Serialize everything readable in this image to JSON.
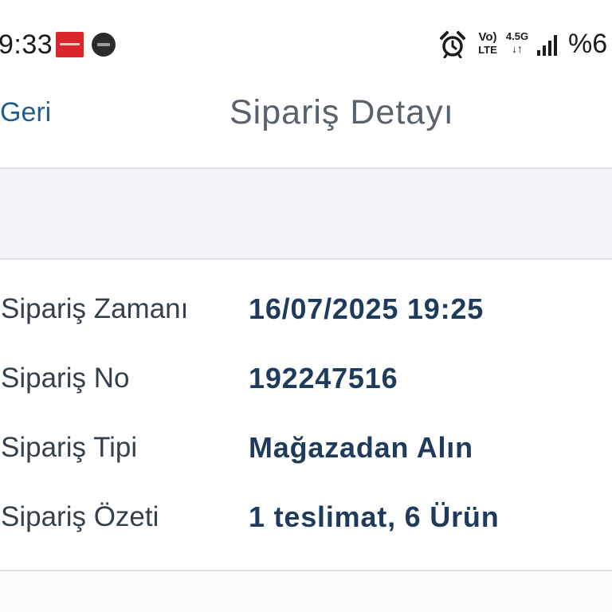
{
  "status_bar": {
    "time": "9:33",
    "volte_top": "Vo)",
    "volte_bottom": "LTE",
    "network_type": "4.5G",
    "network_arrows": "↓↑",
    "battery": "%6",
    "icons": [
      "app-notification-red-icon",
      "app-notification-dark-icon",
      "alarm-clock-icon",
      "signal-strength-icon"
    ]
  },
  "header": {
    "back_label": "Geri",
    "title": "Sipariş Detayı"
  },
  "order_details": {
    "rows": [
      {
        "label": "Sipariş Zamanı",
        "value": "16/07/2025 19:25"
      },
      {
        "label": "Sipariş No",
        "value": "192247516"
      },
      {
        "label": "Sipariş Tipi",
        "value": "Mağazadan Alın"
      },
      {
        "label": "Sipariş Özeti",
        "value": "1 teslimat, 6 Ürün"
      }
    ]
  },
  "colors": {
    "link": "#1f5f8f",
    "title": "#59626b",
    "label": "#34404d",
    "value": "#1f3b5c",
    "band": "#f3f5f8",
    "divider": "#dde1e5",
    "notification_red": "#d8262c"
  }
}
